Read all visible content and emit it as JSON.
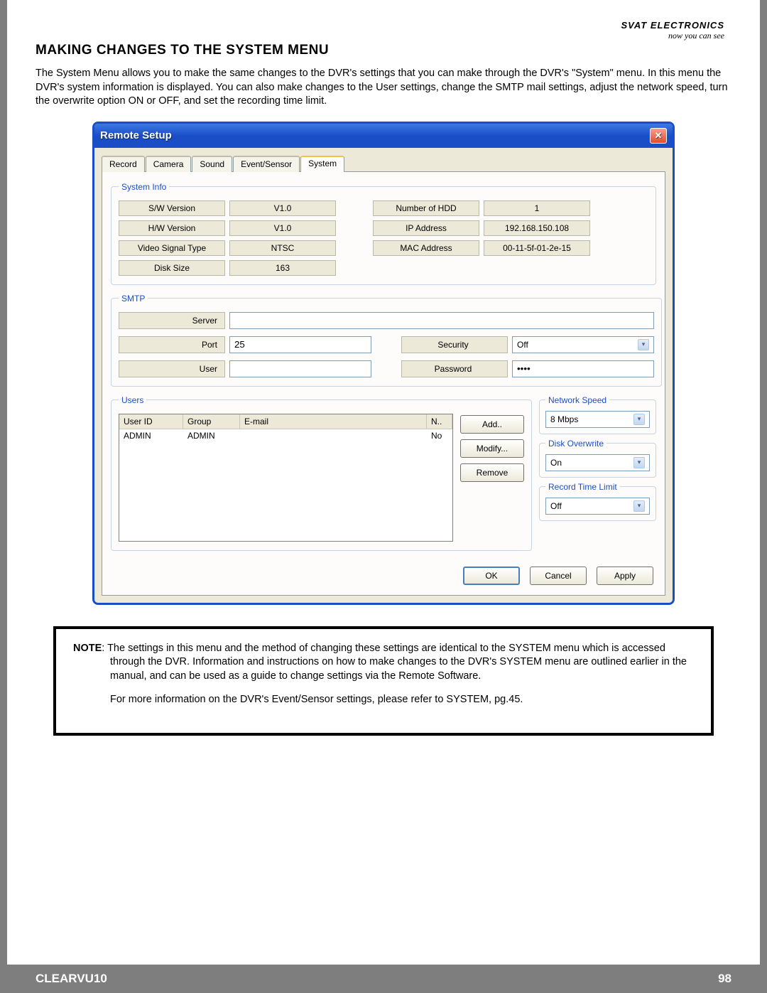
{
  "header": {
    "brand": "SVAT ELECTRONICS",
    "tagline": "now you can see"
  },
  "section_title": "MAKING CHANGES TO THE SYSTEM MENU",
  "intro": "The System Menu allows you to make the same changes to the DVR's settings that you can make through the DVR's \"System\" menu.  In this menu the DVR's system information is displayed.  You can also make changes to the User settings, change the SMTP mail settings, adjust the network speed, turn the overwrite option ON or OFF, and set the recording time limit.",
  "dialog": {
    "title": "Remote Setup",
    "tabs": [
      "Record",
      "Camera",
      "Sound",
      "Event/Sensor",
      "System"
    ],
    "active_tab": "System",
    "system_info": {
      "legend": "System Info",
      "left": [
        {
          "label": "S/W Version",
          "value": "V1.0"
        },
        {
          "label": "H/W Version",
          "value": "V1.0"
        },
        {
          "label": "Video Signal Type",
          "value": "NTSC"
        },
        {
          "label": "Disk Size",
          "value": "163"
        }
      ],
      "right": [
        {
          "label": "Number of HDD",
          "value": "1"
        },
        {
          "label": "IP Address",
          "value": "192.168.150.108"
        },
        {
          "label": "MAC Address",
          "value": "00-11-5f-01-2e-15"
        }
      ]
    },
    "smtp": {
      "legend": "SMTP",
      "server_label": "Server",
      "server_value": "",
      "port_label": "Port",
      "port_value": "25",
      "security_label": "Security",
      "security_value": "Off",
      "user_label": "User",
      "user_value": "",
      "password_label": "Password",
      "password_value": "••••"
    },
    "users": {
      "legend": "Users",
      "columns": {
        "userid": "User ID",
        "group": "Group",
        "email": "E-mail",
        "n": "N.."
      },
      "rows": [
        {
          "userid": "ADMIN",
          "group": "ADMIN",
          "email": "",
          "n": "No"
        }
      ],
      "buttons": {
        "add": "Add..",
        "modify": "Modify...",
        "remove": "Remove"
      }
    },
    "network_speed": {
      "legend": "Network Speed",
      "value": "8 Mbps"
    },
    "disk_overwrite": {
      "legend": "Disk Overwrite",
      "value": "On"
    },
    "record_time_limit": {
      "legend": "Record Time Limit",
      "value": "Off"
    },
    "buttons": {
      "ok": "OK",
      "cancel": "Cancel",
      "apply": "Apply"
    }
  },
  "note": {
    "label": "NOTE",
    "text1": ":  The settings in this menu and the method of changing these settings are identical to the SYSTEM menu which is accessed through the DVR.  Information and instructions on how to make changes to the DVR's SYSTEM menu are outlined earlier in the manual, and can be used as a guide to change settings via the Remote Software.",
    "text2": "For more information on the DVR's Event/Sensor settings, please refer to SYSTEM, pg.45."
  },
  "footer": {
    "model": "CLEARVU10",
    "page": "98"
  }
}
